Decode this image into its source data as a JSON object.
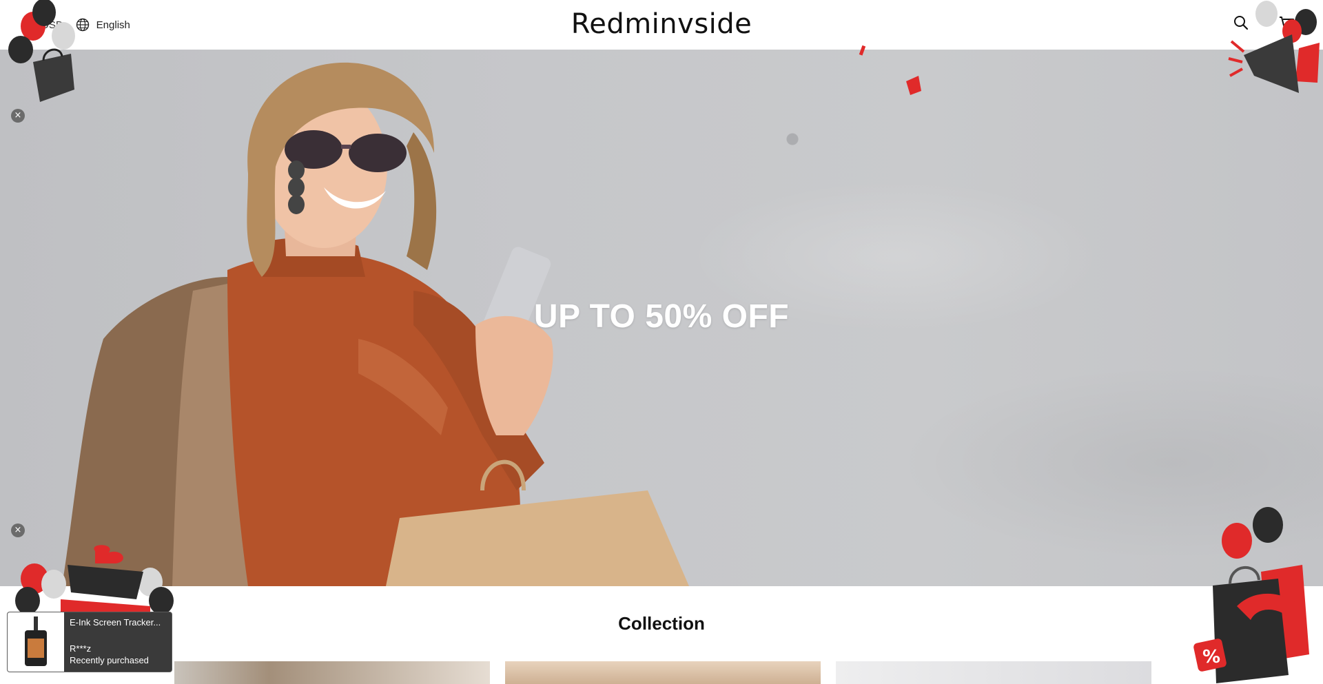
{
  "header": {
    "currency": "USD",
    "language": "English",
    "brand": "Redminvside"
  },
  "hero": {
    "headline": "UP TO 50% OFF"
  },
  "collection": {
    "title": "Collection"
  },
  "recent_purchase": {
    "product": "E-Ink Screen Tracker...",
    "buyer": "R***z",
    "status": "Recently purchased"
  },
  "colors": {
    "accent_red": "#e02a2a",
    "balloon_black": "#2b2b2b",
    "balloon_silver": "#d8d8d8"
  },
  "icons": [
    "globe-icon",
    "search-icon",
    "cart-icon",
    "close-icon",
    "megaphone-icon",
    "shopping-bag-icon",
    "balloon-icon",
    "gift-box-icon"
  ]
}
